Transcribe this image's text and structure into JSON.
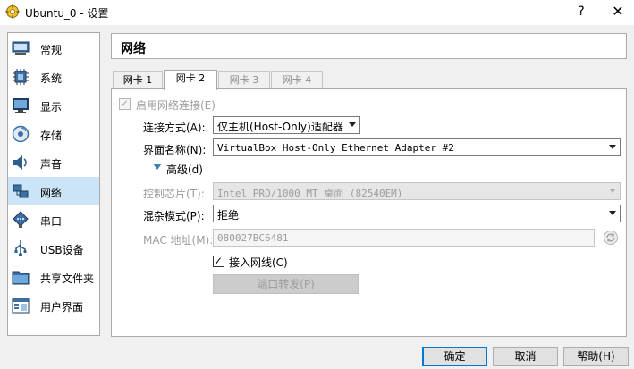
{
  "window": {
    "title": "Ubuntu_0 - 设置",
    "help_glyph": "?",
    "close_glyph": "✕"
  },
  "sidebar": {
    "items": [
      {
        "label": "常规",
        "icon": "general-icon",
        "selected": false
      },
      {
        "label": "系统",
        "icon": "system-chip-icon",
        "selected": false
      },
      {
        "label": "显示",
        "icon": "display-monitor-icon",
        "selected": false
      },
      {
        "label": "存储",
        "icon": "storage-disk-icon",
        "selected": false
      },
      {
        "label": "声音",
        "icon": "speaker-icon",
        "selected": false
      },
      {
        "label": "网络",
        "icon": "network-icon",
        "selected": true
      },
      {
        "label": "串口",
        "icon": "serial-port-icon",
        "selected": false
      },
      {
        "label": "USB设备",
        "icon": "usb-icon",
        "selected": false
      },
      {
        "label": "共享文件夹",
        "icon": "shared-folder-icon",
        "selected": false
      },
      {
        "label": "用户界面",
        "icon": "user-interface-icon",
        "selected": false
      }
    ]
  },
  "section": {
    "title": "网络"
  },
  "tabs": [
    {
      "label": "网卡 1",
      "state": "normal"
    },
    {
      "label": "网卡 2",
      "state": "active"
    },
    {
      "label": "网卡 3",
      "state": "disabled"
    },
    {
      "label": "网卡 4",
      "state": "disabled"
    }
  ],
  "form": {
    "enable_adapter": {
      "label": "启用网络连接(E)",
      "checked": true,
      "disabled": true,
      "check_glyph": "✓"
    },
    "attached_to": {
      "label": "连接方式(A):",
      "value": "仅主机(Host-Only)适配器"
    },
    "name": {
      "label": "界面名称(N):",
      "value": "VirtualBox Host-Only Ethernet Adapter #2"
    },
    "advanced": {
      "label": "高级(d)"
    },
    "adapter_type": {
      "label": "控制芯片(T):",
      "value": "Intel PRO/1000 MT 桌面 (82540EM)",
      "disabled": true
    },
    "promiscuous": {
      "label": "混杂模式(P):",
      "value": "拒绝"
    },
    "mac": {
      "label": "MAC 地址(M):",
      "value": "080027BC6481",
      "disabled": true,
      "refresh_icon": "refresh-icon"
    },
    "cable_connected": {
      "label": "接入网线(C)",
      "checked": true,
      "check_glyph": "✓"
    },
    "port_forwarding": {
      "label": "端口转发(P)",
      "disabled": true
    }
  },
  "buttons": {
    "ok": "确定",
    "cancel": "取消",
    "help": "帮助(H)"
  },
  "colors": {
    "selection": "#cce4f7",
    "accent": "#0078d7",
    "expander": "#3c7fb1"
  }
}
